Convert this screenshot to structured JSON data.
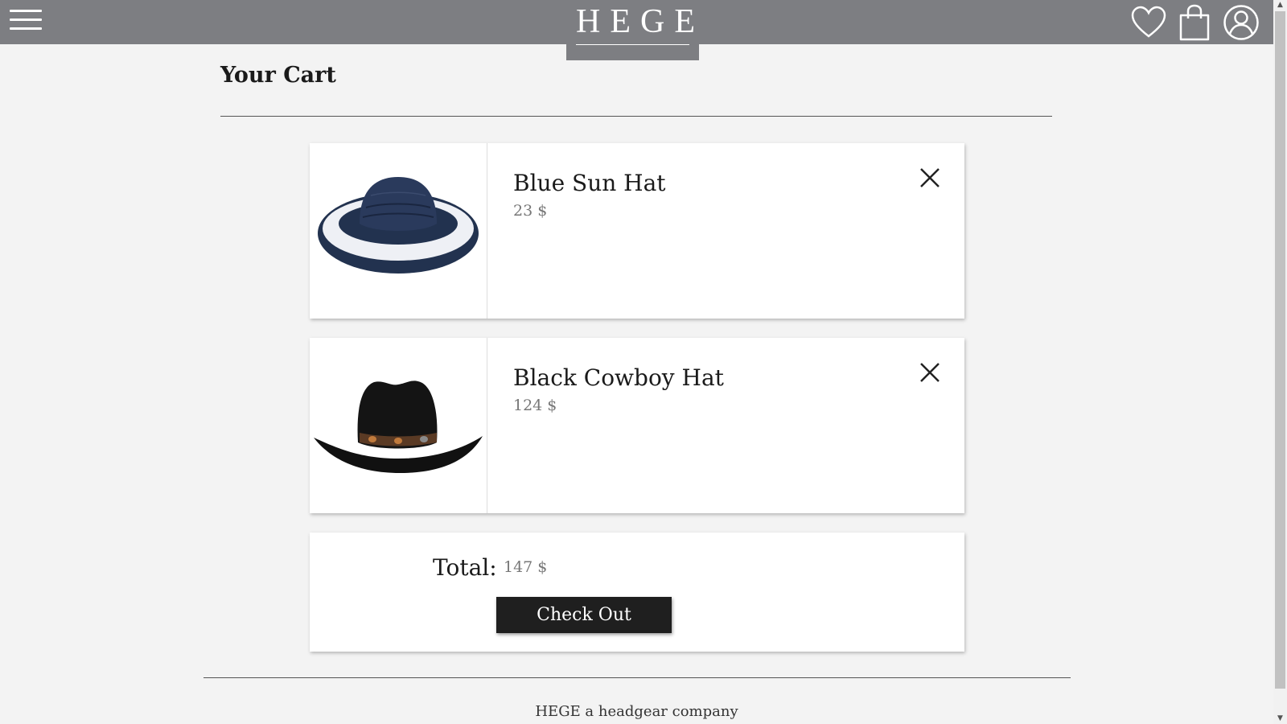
{
  "header": {
    "logo": "HEGE",
    "menu_icon": "hamburger-menu-icon",
    "wishlist_icon": "heart-icon",
    "cart_icon": "shopping-bag-icon",
    "account_icon": "user-circle-icon",
    "background_color": "#7d7e82"
  },
  "page": {
    "title": "Your Cart"
  },
  "cart": {
    "items": [
      {
        "name": "Blue Sun Hat",
        "price": "23 $",
        "image": "blue-sun-hat-image"
      },
      {
        "name": "Black Cowboy Hat",
        "price": "124 $",
        "image": "black-cowboy-hat-image"
      }
    ],
    "total_label": "Total:",
    "total_value": "147 $",
    "checkout_label": "Check Out"
  },
  "footer": {
    "text": "HEGE a headgear company"
  }
}
